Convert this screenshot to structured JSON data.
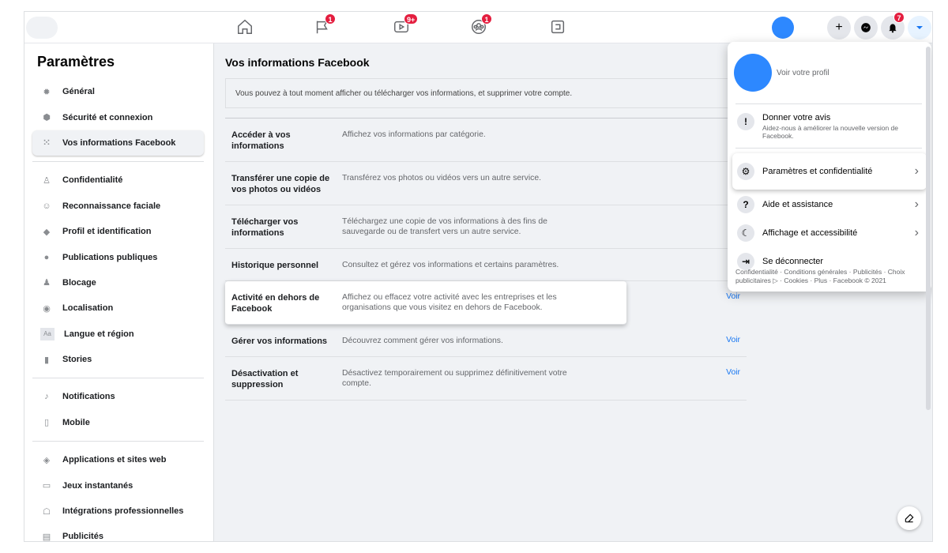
{
  "colors": {
    "accent": "#1877f2",
    "badge": "#e41e3f",
    "avatar": "#2d88ff"
  },
  "topbar": {
    "nav": [
      {
        "icon": "home-icon",
        "badge": ""
      },
      {
        "icon": "flag-icon",
        "badge": "1"
      },
      {
        "icon": "watch-icon",
        "badge": "9+"
      },
      {
        "icon": "groups-icon",
        "badge": "1"
      },
      {
        "icon": "gaming-icon",
        "badge": ""
      }
    ],
    "notifications_badge": "7"
  },
  "sidebar": {
    "title": "Paramètres",
    "items": [
      {
        "label": "Général",
        "icon": "gear-icon"
      },
      {
        "label": "Sécurité et connexion",
        "icon": "shield-icon"
      },
      {
        "label": "Vos informations Facebook",
        "icon": "facebook-info-icon",
        "selected": true
      },
      {
        "label": "Confidentialité",
        "icon": "lock-icon"
      },
      {
        "label": "Reconnaissance faciale",
        "icon": "face-icon"
      },
      {
        "label": "Profil et identification",
        "icon": "tag-icon"
      },
      {
        "label": "Publications publiques",
        "icon": "globe-icon"
      },
      {
        "label": "Blocage",
        "icon": "block-user-icon"
      },
      {
        "label": "Localisation",
        "icon": "location-icon"
      },
      {
        "label": "Langue et région",
        "icon": "language-icon"
      },
      {
        "label": "Stories",
        "icon": "book-icon"
      },
      {
        "label": "Notifications",
        "icon": "bell-icon"
      },
      {
        "label": "Mobile",
        "icon": "mobile-icon"
      },
      {
        "label": "Applications et sites web",
        "icon": "cube-icon"
      },
      {
        "label": "Jeux instantanés",
        "icon": "gamepad-icon"
      },
      {
        "label": "Intégrations professionnelles",
        "icon": "integration-icon"
      },
      {
        "label": "Publicités",
        "icon": "ads-icon"
      }
    ]
  },
  "main": {
    "title": "Vos informations Facebook",
    "intro": "Vous pouvez à tout moment afficher ou télécharger vos informations, et supprimer votre compte.",
    "rows": [
      {
        "label": "Accéder à vos informations",
        "desc": "Affichez vos informations par catégorie.",
        "action": ""
      },
      {
        "label": "Transférer une copie de vos photos ou vidéos",
        "desc": "Transférez vos photos ou vidéos vers un autre service.",
        "action": ""
      },
      {
        "label": "Télécharger vos informations",
        "desc": "Téléchargez une copie de vos informations à des fins de sauvegarde ou de transfert vers un autre service.",
        "action": ""
      },
      {
        "label": "Historique personnel",
        "desc": "Consultez et gérez vos informations et certains paramètres.",
        "action": ""
      },
      {
        "label": "Activité en dehors de Facebook",
        "desc": "Affichez ou effacez votre activité avec les entreprises et les organisations que vous visitez en dehors de Facebook.",
        "action": "Voir"
      },
      {
        "label": "Gérer vos informations",
        "desc": "Découvrez comment gérer vos informations.",
        "action": "Voir"
      },
      {
        "label": "Désactivation et suppression",
        "desc": "Désactivez temporairement ou supprimez définitivement votre compte.",
        "action": "Voir"
      }
    ]
  },
  "dropdown": {
    "profile": "Voir votre profil",
    "feedback_title": "Donner votre avis",
    "feedback_sub": "Aidez-nous à améliorer la nouvelle version de Facebook.",
    "items": [
      {
        "label": "Paramètres et confidentialité",
        "icon": "gear-icon"
      },
      {
        "label": "Aide et assistance",
        "icon": "help-icon"
      },
      {
        "label": "Affichage et accessibilité",
        "icon": "moon-icon"
      },
      {
        "label": "Se déconnecter",
        "icon": "logout-icon"
      }
    ],
    "footer": "Confidentialité · Conditions générales · Publicités · Choix publicitaires ▷ · Cookies · Plus · Facebook © 2021"
  }
}
